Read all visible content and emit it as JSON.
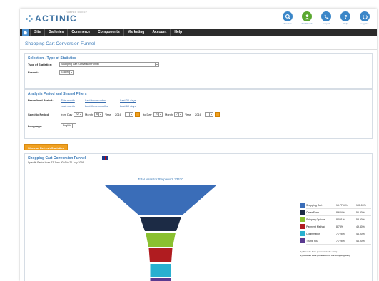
{
  "header": {
    "logo_text": "ACTINIC",
    "logo_sub": "TAMPER GROUP",
    "icons": [
      {
        "label": "Preview",
        "icon": "search-icon",
        "color": "#3a86c8"
      },
      {
        "label": "Dashboard",
        "icon": "user-icon",
        "color": "#5aa830"
      },
      {
        "label": "Support",
        "icon": "phone-icon",
        "color": "#3a86c8"
      },
      {
        "label": "Help",
        "icon": "help-icon",
        "color": "#3a86c8"
      },
      {
        "label": "Log Out",
        "icon": "power-icon",
        "color": "#3a86c8"
      }
    ]
  },
  "nav": {
    "items": [
      "Site",
      "Galleries",
      "Commerce",
      "Components",
      "Marketing",
      "Account",
      "Help"
    ]
  },
  "page_title": "Shopping Cart Conversion Funnel",
  "selection": {
    "title": "Selection - Type of Statistics",
    "type_label": "Type of Statistics:",
    "type_value": "Shopping Cart Conversion Funnel",
    "format_label": "Format:",
    "format_value": "Graph"
  },
  "period": {
    "title": "Analysis Period and Shared Filters",
    "predefined_label": "Predefined Period:",
    "links": [
      "This month",
      "Last two months",
      "Last 30 days",
      "Last month",
      "Last three months",
      "Last 60 days"
    ],
    "specific_label": "Specific Period:",
    "from_day_label": "from Day",
    "from_day": "22",
    "month_label": "Month",
    "from_month": "6",
    "year_label": "Year",
    "from_year": "2016",
    "to_day_label": "to Day",
    "to_day": "21",
    "to_month": "7",
    "to_year": "2016",
    "language_label": "Language:",
    "language_value": "English"
  },
  "refresh_button": "Show or Refresh Statistics",
  "funnel": {
    "title": "Shopping Cart Conversion Funnel",
    "subtitle": "Specific Period from 22 June 2016 to 21 July 2016",
    "total": "Total visits for the period: 33430",
    "stages": [
      {
        "name": "Shopping Cart",
        "abs": "19.7794%",
        "rel": "100.00%",
        "color": "#3a6db8"
      },
      {
        "name": "Order Form",
        "abs": "8.644%",
        "rel": "56.20%",
        "color": "#1c2b45"
      },
      {
        "name": "Shipping Options",
        "abs": "8.091%",
        "rel": "53.50%",
        "color": "#8ac030"
      },
      {
        "name": "Payment Method",
        "abs": "8.78%",
        "rel": "49.40%",
        "color": "#b01c20"
      },
      {
        "name": "Confirmation",
        "abs": "7.725%",
        "rel": "46.00%",
        "color": "#2ab0d0"
      },
      {
        "name": "Thank You",
        "abs": "7.725%",
        "rel": "46.00%",
        "color": "#5a3a90"
      }
    ],
    "note1_prefix": "(1)",
    "note1": "Absolute Rate (percent of site visits)",
    "note2_prefix": "(2)",
    "note2": "Relative Rate (in relation to the shopping cart)"
  }
}
